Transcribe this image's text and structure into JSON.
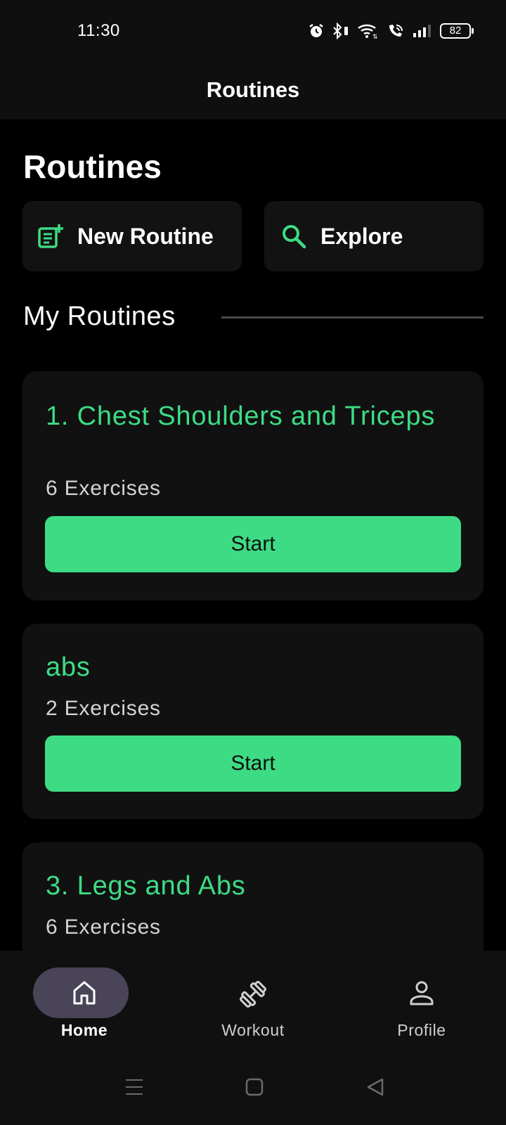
{
  "status_bar": {
    "time": "11:30",
    "battery": "82",
    "icons": [
      "alarm-icon",
      "bluetooth-icon",
      "wifi-icon",
      "wifi-calling-icon",
      "signal-icon",
      "battery-icon"
    ]
  },
  "app_bar": {
    "title": "Routines"
  },
  "page": {
    "heading": "Routines",
    "new_routine_label": "New Routine",
    "explore_label": "Explore",
    "section_title": "My Routines"
  },
  "routines": [
    {
      "title": "1. Chest Shoulders and Triceps",
      "count": "6 Exercises",
      "start_label": "Start"
    },
    {
      "title": "abs",
      "count": "2 Exercises",
      "start_label": "Start"
    },
    {
      "title": "3. Legs and Abs",
      "count": "6 Exercises"
    }
  ],
  "bottom_nav": {
    "items": [
      {
        "label": "Home",
        "icon": "home-icon",
        "active": true
      },
      {
        "label": "Workout",
        "icon": "dumbbell-icon",
        "active": false
      },
      {
        "label": "Profile",
        "icon": "person-icon",
        "active": false
      }
    ]
  },
  "colors": {
    "accent": "#3ddc84",
    "background": "#000000",
    "surface": "#111111",
    "nav_active_pill": "#4a4458"
  }
}
